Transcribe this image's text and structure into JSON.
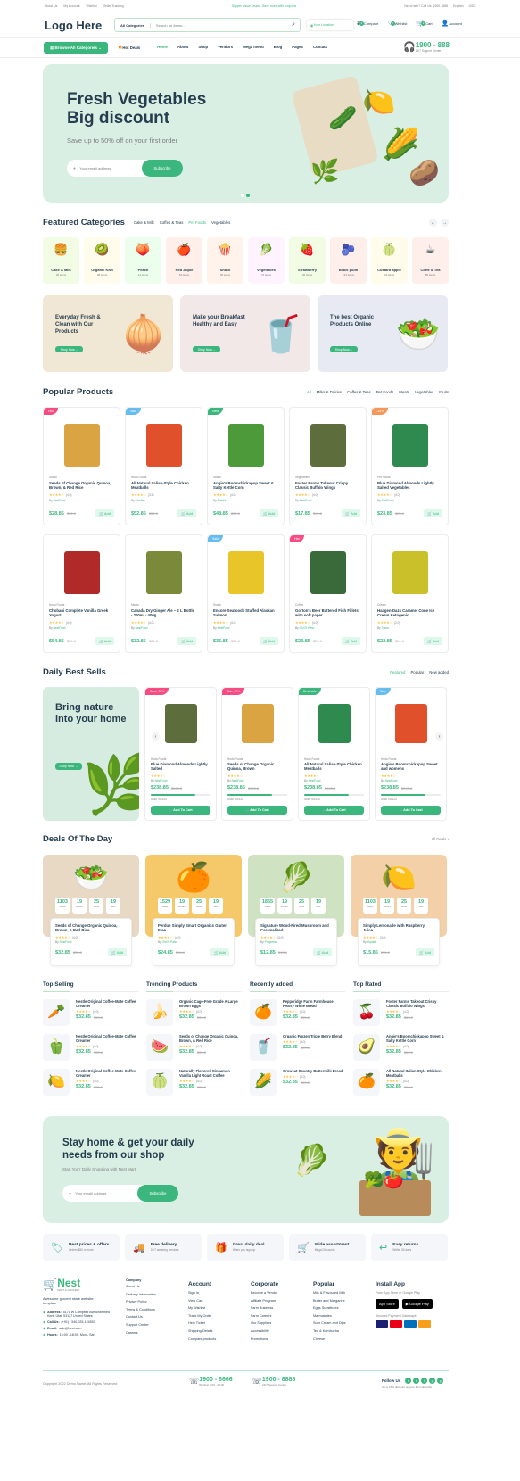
{
  "topbar": {
    "links": [
      "About Us",
      "My Account",
      "Wishlist",
      "Order Tracking"
    ],
    "promo": "Supper Value Deals - Save more with coupons",
    "help": "Need help? Call Us: 1900 - 888",
    "lang": "English",
    "currency": "USD"
  },
  "header": {
    "logo": "Logo Here",
    "category_select": "All Categories",
    "search_placeholder": "Search for items...",
    "location": "Your Location",
    "compare": "Compare",
    "compare_count": "3",
    "wishlist": "Wishlist",
    "wishlist_count": "6",
    "cart": "Cart",
    "cart_count": "2",
    "account": "Account"
  },
  "nav": {
    "browse": "Browse All Categories",
    "hot": "Hot Deals",
    "items": [
      "Home",
      "About",
      "Shop",
      "Vendors",
      "Mega menu",
      "Blog",
      "Pages",
      "Contact"
    ],
    "phone": "1900 - 888",
    "support": "24/7 Support Center"
  },
  "hero": {
    "title1": "Fresh Vegetables",
    "title2": "Big discount",
    "subtitle": "Save up to 50% off on your first order",
    "placeholder": "Your emaill address",
    "button": "Subscribe"
  },
  "featured": {
    "title": "Featured Categories",
    "tabs": [
      "Cake & Milk",
      "Coffes & Teas",
      "Pet Foods",
      "Vegetables"
    ],
    "items": [
      {
        "name": "Cake & Milk",
        "count": "26 items",
        "bg": "#f2fce4",
        "icon": "🍔"
      },
      {
        "name": "Organic Kiwi",
        "count": "28 items",
        "bg": "#fffceb",
        "icon": "🥝"
      },
      {
        "name": "Peach",
        "count": "14 items",
        "bg": "#ecffec",
        "icon": "🍑"
      },
      {
        "name": "Red Apple",
        "count": "54 items",
        "bg": "#feefea",
        "icon": "🍎"
      },
      {
        "name": "Snack",
        "count": "56 items",
        "bg": "#fff3eb",
        "icon": "🍿"
      },
      {
        "name": "Vegetables",
        "count": "72 items",
        "bg": "#fff3ff",
        "icon": "🥬"
      },
      {
        "name": "Strawberry",
        "count": "36 items",
        "bg": "#f2fce4",
        "icon": "🍓"
      },
      {
        "name": "Black plum",
        "count": "123 items",
        "bg": "#feefea",
        "icon": "🫐"
      },
      {
        "name": "Custard apple",
        "count": "34 items",
        "bg": "#fffceb",
        "icon": "🍈"
      },
      {
        "name": "Coffe & Tea",
        "count": "89 items",
        "bg": "#feefea",
        "icon": "☕"
      }
    ]
  },
  "banners": [
    {
      "text": "Everyday Fresh & Clean with Our Products",
      "btn": "Shop Now",
      "bg": "#f0e8d5",
      "icon": "🧅"
    },
    {
      "text": "Make your Breakfast Healthy and Easy",
      "btn": "Shop Now",
      "bg": "#f3e8e8",
      "icon": "🥤"
    },
    {
      "text": "The best Organic Products Online",
      "btn": "Shop Now",
      "bg": "#e7eaf3",
      "icon": "🥗"
    }
  ],
  "popular": {
    "title": "Popular Products",
    "tabs": [
      "All",
      "Milks & Dairies",
      "Coffes & Teas",
      "Pet Foods",
      "Meats",
      "Vegetables",
      "Fruits"
    ],
    "products": [
      {
        "badge": "Hot",
        "badge_color": "#f74b81",
        "cat": "Snack",
        "name": "Seeds of Change Organic Quinoa, Brown, & Red Rice",
        "rating": "(4.0)",
        "by": "NestFood",
        "price": "$28.85",
        "old": "$32.8",
        "add": "Add",
        "pack": "#d9a441"
      },
      {
        "badge": "Sale",
        "badge_color": "#67bcee",
        "cat": "Hodo Foods",
        "name": "All Natural Italian-Style Chicken Meatballs",
        "rating": "(3.5)",
        "by": "Stouffer",
        "price": "$52.85",
        "old": "$55.8",
        "add": "Add",
        "pack": "#e0502a"
      },
      {
        "badge": "New",
        "badge_color": "#3bb77e",
        "cat": "Snack",
        "name": "Angie's Boomchickapop Sweet & Salty Kettle Corn",
        "rating": "(4.0)",
        "by": "StarKist",
        "price": "$48.85",
        "old": "$52.8",
        "add": "Add",
        "pack": "#4c9a3a"
      },
      {
        "badge": "",
        "badge_color": "",
        "cat": "Vegetables",
        "name": "Foster Farms Takeout Crispy Classic Buffalo Wings",
        "rating": "(4.0)",
        "by": "NestFood",
        "price": "$17.85",
        "old": "$19.8",
        "add": "Add",
        "pack": "#5d6e3c"
      },
      {
        "badge": "-14%",
        "badge_color": "#f59758",
        "cat": "Pet Foods",
        "name": "Blue Diamond Almonds Lightly Salted Vegetables",
        "rating": "(4.0)",
        "by": "NestFood",
        "price": "$23.85",
        "old": "$25.8",
        "add": "Add",
        "pack": "#2e8a4e"
      },
      {
        "badge": "",
        "badge_color": "",
        "cat": "Hodo Foods",
        "name": "Chobani Complete Vanilla Greek Yogurt",
        "rating": "(4.0)",
        "by": "NestFood",
        "price": "$54.85",
        "old": "$55.8",
        "add": "Add",
        "pack": "#b02a2a"
      },
      {
        "badge": "",
        "badge_color": "",
        "cat": "Meats",
        "name": "Canada Dry Ginger Ale – 2 L Bottle - 200ml - 400g",
        "rating": "(4.0)",
        "by": "NestFood",
        "price": "$32.85",
        "old": "$33.8",
        "add": "Add",
        "pack": "#7a8a3a"
      },
      {
        "badge": "Sale",
        "badge_color": "#67bcee",
        "cat": "Snack",
        "name": "Encore Seafoods Stuffed Alaskan Salmon",
        "rating": "(4.0)",
        "by": "NestFood",
        "price": "$35.85",
        "old": "$37.8",
        "add": "Add",
        "pack": "#e8c62a"
      },
      {
        "badge": "Hot",
        "badge_color": "#f74b81",
        "cat": "Coffes",
        "name": "Gorton's Beer Battered Fish Fillets with soft paper",
        "rating": "(4.0)",
        "by": "Old El Paso",
        "price": "$23.85",
        "old": "$25.8",
        "add": "Add",
        "pack": "#3a6a3a"
      },
      {
        "badge": "",
        "badge_color": "",
        "cat": "Cream",
        "name": "Haagen-Dazs Caramel Cone Ice Cream Ketogenic",
        "rating": "(2.0)",
        "by": "Tyson",
        "price": "$22.85",
        "old": "$24.8",
        "add": "Add",
        "pack": "#c9c02a"
      }
    ]
  },
  "daily": {
    "title": "Daily Best Sells",
    "tabs": [
      "Featured",
      "Popular",
      "New added"
    ],
    "promo": "Bring nature into your home",
    "promo_btn": "Shop Now",
    "items": [
      {
        "badge": "Save 15%",
        "badge_color": "#f74b81",
        "cat": "Hodo Foods",
        "name": "Blue Diamond Almonds Lightly Salted",
        "by": "NestFood",
        "price": "$238.85",
        "old": "$245.8",
        "sold": "Sold: 90/120",
        "progress": 0.75,
        "btn": "Add To Cart",
        "pack": "#5d6e3c"
      },
      {
        "badge": "Sale 12%",
        "badge_color": "#f74b81",
        "cat": "Hodo Foods",
        "name": "Seeds of Change Organic Quinoa, Brown",
        "by": "NestFood",
        "price": "$238.85",
        "old": "$245.8",
        "sold": "Sold: 90/120",
        "progress": 0.75,
        "btn": "Add To Cart",
        "pack": "#d9a441"
      },
      {
        "badge": "Best sale",
        "badge_color": "#3bb77e",
        "cat": "Hodo Foods",
        "name": "All Natural Italian-Style Chicken Meatballs",
        "by": "NestFood",
        "price": "$238.85",
        "old": "$245.8",
        "sold": "Sold: 90/120",
        "progress": 0.75,
        "btn": "Add To Cart",
        "pack": "#2e8a4e"
      },
      {
        "badge": "Sale",
        "badge_color": "#67bcee",
        "cat": "Hodo Foods",
        "name": "Angie's Boomchickapop Sweet and womens",
        "by": "NestFood",
        "price": "$238.85",
        "old": "$245.8",
        "sold": "Sold: 90/120",
        "progress": 0.75,
        "btn": "Add To Cart",
        "pack": "#e0502a"
      }
    ]
  },
  "deals": {
    "title": "Deals Of The Day",
    "all": "All Deals",
    "timer_labels": [
      "Days",
      "Hours",
      "Mins",
      "Sec"
    ],
    "items": [
      {
        "timer": [
          "1103",
          "19",
          "25",
          "19"
        ],
        "name": "Seeds of Change Organic Quinoa, Brown, & Red Rice",
        "rating": "(4.0)",
        "by": "NestFood",
        "price": "$32.85",
        "old": "$33.8",
        "add": "Add",
        "bg": "#e8d9c4",
        "icon": "🥗"
      },
      {
        "timer": [
          "1529",
          "19",
          "25",
          "19"
        ],
        "name": "Perdue Simply Smart Organics Gluten Free",
        "rating": "(4.0)",
        "by": "Old El Paso",
        "price": "$24.85",
        "old": "$26.8",
        "add": "Add",
        "bg": "#f5c96a",
        "icon": "🍊"
      },
      {
        "timer": [
          "1865",
          "19",
          "25",
          "19"
        ],
        "name": "Signature Wood-Fired Mushroom and Caramelized",
        "rating": "(3.0)",
        "by": "Progresso",
        "price": "$12.85",
        "old": "$13.8",
        "add": "Add",
        "bg": "#cfe3c2",
        "icon": "🥬"
      },
      {
        "timer": [
          "1103",
          "19",
          "25",
          "19"
        ],
        "name": "Simply Lemonade with Raspberry Juice",
        "rating": "(3.0)",
        "by": "Yoplait",
        "price": "$15.85",
        "old": "$16.8",
        "add": "Add",
        "bg": "#f3d0a8",
        "icon": "🍋"
      }
    ]
  },
  "lists": [
    {
      "title": "Top Selling",
      "items": [
        {
          "name": "Nestle Original Coffee-Mate Coffee Creamer",
          "rating": "(4.0)",
          "price": "$32.85",
          "old": "$33.8",
          "icon": "🥕"
        },
        {
          "name": "Nestle Original Coffee-Mate Coffee Creamer",
          "rating": "(4.0)",
          "price": "$32.85",
          "old": "$33.8",
          "icon": "🫑"
        },
        {
          "name": "Nestle Original Coffee-Mate Coffee Creamer",
          "rating": "(4.0)",
          "price": "$32.85",
          "old": "$33.8",
          "icon": "🍋"
        }
      ]
    },
    {
      "title": "Trending Products",
      "items": [
        {
          "name": "Organic Cage-Free Grade A Large Brown Eggs",
          "rating": "(4.0)",
          "price": "$32.85",
          "old": "$33.8",
          "icon": "🍌"
        },
        {
          "name": "Seeds of Change Organic Quinoa, Brown, & Red Rice",
          "rating": "(4.0)",
          "price": "$32.85",
          "old": "$33.8",
          "icon": "🍉"
        },
        {
          "name": "Naturally Flavored Cinnamon Vanilla Light Roast Coffee",
          "rating": "(4.0)",
          "price": "$32.85",
          "old": "$33.8",
          "icon": "🍈"
        }
      ]
    },
    {
      "title": "Recently added",
      "items": [
        {
          "name": "Pepperidge Farm Farmhouse Hearty White Bread",
          "rating": "(4.0)",
          "price": "$32.85",
          "old": "$33.8",
          "icon": "🍊"
        },
        {
          "name": "Organic Frozen Triple Berry Blend",
          "rating": "(4.0)",
          "price": "$32.85",
          "old": "$33.8",
          "icon": "🥤"
        },
        {
          "name": "Oroweat Country Buttermilk Bread",
          "rating": "(4.0)",
          "price": "$32.85",
          "old": "$33.8",
          "icon": "🌽"
        }
      ]
    },
    {
      "title": "Top Rated",
      "items": [
        {
          "name": "Foster Farms Takeout Crispy Classic Buffalo Wings",
          "rating": "(4.0)",
          "price": "$32.85",
          "old": "$33.8",
          "icon": "🍒"
        },
        {
          "name": "Angie's Boomchickapop Sweet & Salty Kettle Corn",
          "rating": "(4.0)",
          "price": "$32.85",
          "old": "$33.8",
          "icon": "🥑"
        },
        {
          "name": "All Natural Italian-Style Chicken Meatballs",
          "rating": "(4.0)",
          "price": "$32.85",
          "old": "$33.8",
          "icon": "🍊"
        }
      ]
    }
  ],
  "newsletter": {
    "title1": "Stay home & get your daily",
    "title2": "needs from our shop",
    "subtitle": "Start You'r Daily Shopping with Nest Mart",
    "placeholder": "Your emaill address",
    "button": "Subscribe"
  },
  "features": [
    {
      "title": "Best prices & offers",
      "sub": "Orders $50 or more",
      "icon": "🏷"
    },
    {
      "title": "Free delivery",
      "sub": "24/7 amazing services",
      "icon": "🚚"
    },
    {
      "title": "Great daily deal",
      "sub": "When you sign up",
      "icon": "🎁"
    },
    {
      "title": "Wide assortment",
      "sub": "Mega Discounts",
      "icon": "🛒"
    },
    {
      "title": "Easy returns",
      "sub": "Within 30 days",
      "icon": "↩"
    }
  ],
  "footer": {
    "brand": "Nest",
    "brand_sub": "MART & GROCERY",
    "about": "Awesome grocery store website template",
    "contact": [
      {
        "label": "Address:",
        "value": "5171 W Campbell Ave undefined Kent, Utah 53127 United States"
      },
      {
        "label": "Call Us:",
        "value": "(+91) - 540-025-124553"
      },
      {
        "label": "Email:",
        "value": "sale@Nest.com"
      },
      {
        "label": "Hours:",
        "value": "10:00 - 18:00, Mon - Sat"
      }
    ],
    "company_title": "Company",
    "company": [
      "About Us",
      "Delivery Information",
      "Privacy Policy",
      "Terms & Conditions",
      "Contact Us",
      "Support Center",
      "Careers"
    ],
    "account_title": "Account",
    "account": [
      "Sign In",
      "View Cart",
      "My Wishlist",
      "Track My Order",
      "Help Ticket",
      "Shipping Details",
      "Compare products"
    ],
    "corporate_title": "Corporate",
    "corporate": [
      "Become a Vendor",
      "Affiliate Program",
      "Farm Business",
      "Farm Careers",
      "Our Suppliers",
      "Accessibility",
      "Promotions"
    ],
    "popular_title": "Popular",
    "popular": [
      "Milk & Flavoured Milk",
      "Butter and Margarine",
      "Eggs Substitutes",
      "Marmalades",
      "Sour Cream and Dips",
      "Tea & Kombucha",
      "Cheese"
    ],
    "app_title": "Install App",
    "app_sub": "From App Store or Google Play",
    "appstore": "App Store",
    "googleplay": "Google Play",
    "payment": "Secured Payment Gateways",
    "copyright": "Copyright 2022 Demo Name. All Rights Reserved",
    "phone1": "1900 - 6666",
    "phone1_sub": "Working 8:00 - 22:00",
    "phone2": "1900 - 8888",
    "phone2_sub": "24/7 Support Center",
    "follow": "Follow Us",
    "follow_sub": "Up to 15% discount on your first subscribe"
  },
  "colors": {
    "brand": "#3bb77e",
    "dark": "#253d4e",
    "hot": "#f74b81",
    "sale": "#67bcee",
    "star": "#fdc040"
  }
}
